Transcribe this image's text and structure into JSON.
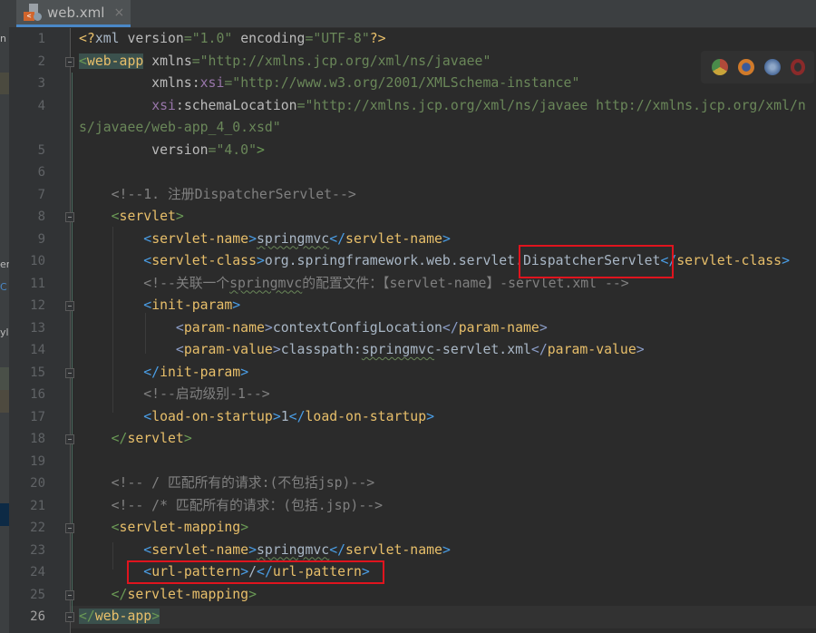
{
  "tab": {
    "filename": "web.xml",
    "close": "×"
  },
  "left_panel_fragments": [
    "n",
    "er",
    "C",
    "yl"
  ],
  "browser_icons": [
    "chrome-icon",
    "firefox-icon",
    "safari-icon",
    "opera-icon"
  ],
  "current_line": 26,
  "lines": [
    [
      [
        "<?",
        "pi"
      ],
      [
        "xml ",
        "tx"
      ],
      [
        "version",
        "at"
      ],
      [
        "=\"1.0\" ",
        "va"
      ],
      [
        "encoding",
        "at"
      ],
      [
        "=\"UTF-8\"",
        "va"
      ],
      [
        "?>",
        "pi"
      ]
    ],
    [
      [
        "<",
        "b1 hl"
      ],
      [
        "web-app",
        "tg hl"
      ],
      [
        " xmlns",
        "at"
      ],
      [
        "=\"http://xmlns.jcp.org/xml/ns/javaee\"",
        "va"
      ]
    ],
    [
      [
        "         xmlns:",
        "at"
      ],
      [
        "xsi",
        "ns"
      ],
      [
        "=\"http://www.w3.org/2001/XMLSchema-instance\"",
        "va"
      ]
    ],
    [
      [
        "         ",
        "tx"
      ],
      [
        "xsi",
        "ns"
      ],
      [
        ":schemaLocation",
        "at"
      ],
      [
        "=\"http://xmlns.jcp.org/xml/ns/javaee http://xmlns.jcp.org/xml/ns/javaee/web-app_4_0.xsd\"",
        "va"
      ]
    ],
    [
      [
        "         version",
        "at"
      ],
      [
        "=\"4.0\"",
        "va"
      ],
      [
        ">",
        "b1"
      ]
    ],
    [],
    [
      [
        "    <!--1. 注册DispatcherServlet-->",
        "cm"
      ]
    ],
    [
      [
        "    <",
        "b1"
      ],
      [
        "servlet",
        "tg"
      ],
      [
        ">",
        "b1"
      ]
    ],
    [
      [
        "        <",
        "b2"
      ],
      [
        "servlet-name",
        "tg"
      ],
      [
        ">",
        "b2"
      ],
      [
        "springmvc",
        "tx sp"
      ],
      [
        "</",
        "b2"
      ],
      [
        "servlet-name",
        "tg"
      ],
      [
        ">",
        "b2"
      ]
    ],
    [
      [
        "        <",
        "b2"
      ],
      [
        "servlet-class",
        "tg"
      ],
      [
        ">",
        "b2"
      ],
      [
        "org.springframework.web.servlet.DispatcherServlet",
        "tx"
      ],
      [
        "</",
        "b2"
      ],
      [
        "servlet-class",
        "tg"
      ],
      [
        ">",
        "b2"
      ]
    ],
    [
      [
        "        <!--关联一个",
        "cm"
      ],
      [
        "springmvc",
        "cm sp"
      ],
      [
        "的配置文件：【servlet-name】-servlet.xml -->",
        "cm"
      ]
    ],
    [
      [
        "        <",
        "b2"
      ],
      [
        "init-param",
        "tg"
      ],
      [
        ">",
        "b2"
      ]
    ],
    [
      [
        "            <",
        "b3"
      ],
      [
        "param-name",
        "tg"
      ],
      [
        ">",
        "b3"
      ],
      [
        "contextConfigLocation",
        "tx"
      ],
      [
        "</",
        "b3"
      ],
      [
        "param-name",
        "tg"
      ],
      [
        ">",
        "b3"
      ]
    ],
    [
      [
        "            <",
        "b3"
      ],
      [
        "param-value",
        "tg"
      ],
      [
        ">",
        "b3"
      ],
      [
        "classpath:",
        "tx"
      ],
      [
        "springmvc",
        "tx sp"
      ],
      [
        "-servlet.xml",
        "tx"
      ],
      [
        "</",
        "b3"
      ],
      [
        "param-value",
        "tg"
      ],
      [
        ">",
        "b3"
      ]
    ],
    [
      [
        "        </",
        "b2"
      ],
      [
        "init-param",
        "tg"
      ],
      [
        ">",
        "b2"
      ]
    ],
    [
      [
        "        <!--启动级别-1-->",
        "cm"
      ]
    ],
    [
      [
        "        <",
        "b2"
      ],
      [
        "load-on-startup",
        "tg"
      ],
      [
        ">",
        "b2"
      ],
      [
        "1",
        "tx"
      ],
      [
        "</",
        "b2"
      ],
      [
        "load-on-startup",
        "tg"
      ],
      [
        ">",
        "b2"
      ]
    ],
    [
      [
        "    </",
        "b1"
      ],
      [
        "servlet",
        "tg"
      ],
      [
        ">",
        "b1"
      ]
    ],
    [],
    [
      [
        "    <!-- / 匹配所有的请求:(不包括jsp)-->",
        "cm"
      ]
    ],
    [
      [
        "    <!-- /* 匹配所有的请求：(包括.jsp)-->",
        "cm"
      ]
    ],
    [
      [
        "    <",
        "b1"
      ],
      [
        "servlet-mapping",
        "tg"
      ],
      [
        ">",
        "b1"
      ]
    ],
    [
      [
        "        <",
        "b2"
      ],
      [
        "servlet-name",
        "tg"
      ],
      [
        ">",
        "b2"
      ],
      [
        "springmvc",
        "tx sp"
      ],
      [
        "</",
        "b2"
      ],
      [
        "servlet-name",
        "tg"
      ],
      [
        ">",
        "b2"
      ]
    ],
    [
      [
        "        <",
        "b2"
      ],
      [
        "url-pattern",
        "tg"
      ],
      [
        ">",
        "b2"
      ],
      [
        "/",
        "tx"
      ],
      [
        "</",
        "b2"
      ],
      [
        "url-pattern",
        "tg"
      ],
      [
        ">",
        "b2"
      ]
    ],
    [
      [
        "    </",
        "b1"
      ],
      [
        "servlet-mapping",
        "tg"
      ],
      [
        ">",
        "b1"
      ]
    ],
    [
      [
        "</",
        "b1 hl"
      ],
      [
        "web-app",
        "tg hl"
      ],
      [
        ">",
        "b1 hl"
      ]
    ]
  ]
}
